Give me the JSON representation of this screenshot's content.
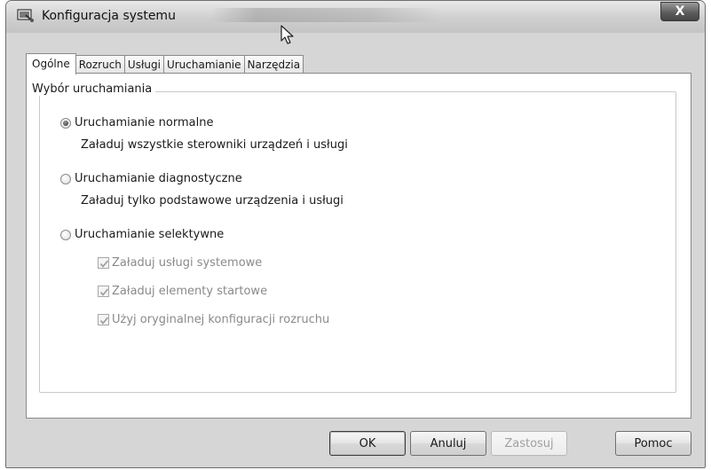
{
  "window": {
    "title": "Konfiguracja systemu",
    "close_label": "X"
  },
  "tabs": [
    {
      "label": "Ogólne",
      "active": true
    },
    {
      "label": "Rozruch",
      "active": false
    },
    {
      "label": "Usługi",
      "active": false
    },
    {
      "label": "Uruchamianie",
      "active": false
    },
    {
      "label": "Narzędzia",
      "active": false
    }
  ],
  "startup_group": {
    "legend": "Wybór uruchamiania",
    "options": [
      {
        "label": "Uruchamianie normalne",
        "description": "Załaduj wszystkie sterowniki urządzeń i usługi",
        "checked": true
      },
      {
        "label": "Uruchamianie diagnostyczne",
        "description": "Załaduj tylko podstawowe urządzenia i usługi",
        "checked": false
      },
      {
        "label": "Uruchamianie selektywne",
        "checked": false
      }
    ],
    "selective_items": [
      {
        "label": "Załaduj usługi systemowe",
        "checked": true,
        "enabled": false
      },
      {
        "label": "Załaduj elementy startowe",
        "checked": true,
        "enabled": false
      },
      {
        "label": "Użyj oryginalnej konfiguracji rozruchu",
        "checked": true,
        "enabled": false
      }
    ]
  },
  "buttons": {
    "ok": "OK",
    "cancel": "Anuluj",
    "apply": "Zastosuj",
    "help": "Pomoc"
  },
  "icons": {
    "app": "msconfig-icon",
    "close": "close-icon",
    "cursor": "mouse-pointer-icon",
    "check": "checkmark-icon"
  }
}
